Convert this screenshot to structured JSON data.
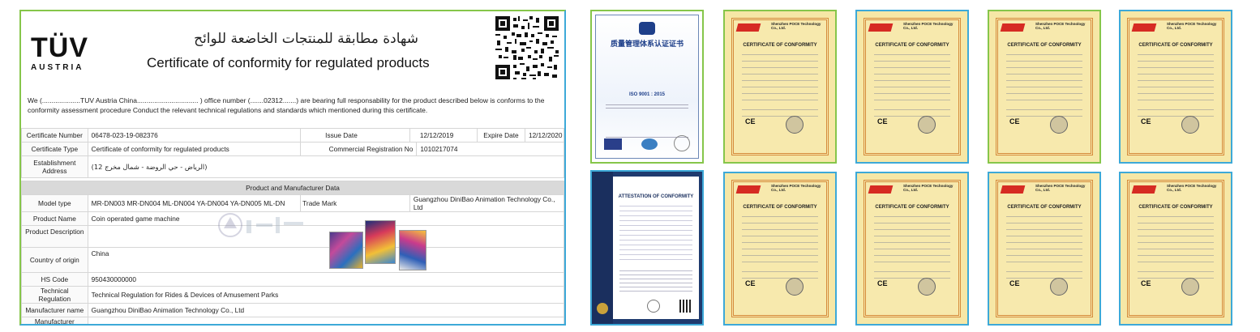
{
  "main_certificate": {
    "logo_text": "TÜV",
    "logo_subtext": "AUSTRIA",
    "title_ar": "شهادة مطابقة للمنتجات الخاضعة للوائح",
    "title_en": "Certificate of conformity for regulated products",
    "intro": "We (....................TUV Austria China................................ ) office number (.......02312.......) are bearing full responsability for the product described below is conforms to the conformity assessment procedure Conduct the relevant technical regulations and standards which mentioned during this certificate.",
    "rows": {
      "certificate_number_label": "Certificate Number",
      "certificate_number": "06478-023-19-082376",
      "issue_date_label": "Issue Date",
      "issue_date": "12/12/2019",
      "expire_date_label": "Expire Date",
      "expire_date": "12/12/2020",
      "certificate_type_label": "Certificate Type",
      "certificate_type": "Certificate of conformity for regulated products",
      "commercial_reg_label": "Commercial Registration No",
      "commercial_reg": "1010217074",
      "establishment_label": "Establishment Address",
      "establishment": "(الرياض - حي الروضة - شمال مخرج 12)",
      "section_title": "Product and Manufacturer Data",
      "model_type_label": "Model type",
      "model_type": "MR-DN003 MR-DN004 ML-DN004 YA-DN004 YA-DN005 ML-DN",
      "trade_mark_label": "Trade Mark",
      "trade_mark": "Guangzhou DiniBao Animation Technology Co., Ltd",
      "product_name_label": "Product Name",
      "product_name": "Coin operated game machine",
      "product_description_label": "Product Description",
      "country_label": "Country of origin",
      "country": "China",
      "hs_code_label": "HS Code",
      "hs_code": "950430000000",
      "tech_reg_label": "Technical Regulation",
      "tech_reg": "Technical Regulation for Rides & Devices of Amusement Parks",
      "manufacturer_name_label": "Manufacturer name",
      "manufacturer_name": "Guangzhou DiniBao Animation Technology Co., Ltd",
      "manufacturer_address_label": "Manufacturer Address"
    }
  },
  "iso_certificate": {
    "title_cn": "质量管理体系认证证书",
    "standard": "ISO 9001 : 2015"
  },
  "attestation": {
    "title": "ATTESTATION OF CONFORMITY"
  },
  "ce_certificates": {
    "company": "Shenzhen POCE Technology Co., Ltd.",
    "title": "CERTIFICATE OF CONFORMITY",
    "mark": "CE"
  }
}
